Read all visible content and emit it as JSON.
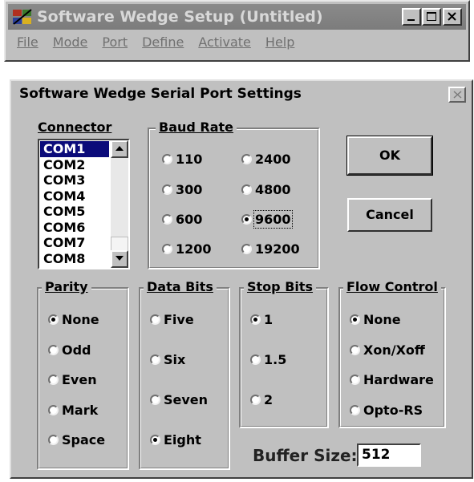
{
  "main_window": {
    "title": "Software Wedge Setup (Untitled)",
    "menu": [
      {
        "label": "File"
      },
      {
        "label": "Mode"
      },
      {
        "label": "Port"
      },
      {
        "label": "Define"
      },
      {
        "label": "Activate"
      },
      {
        "label": "Help"
      }
    ]
  },
  "dialog": {
    "title": "Software Wedge Serial Port Settings",
    "connector": {
      "label": "Connector",
      "items": [
        "COM1",
        "COM2",
        "COM3",
        "COM4",
        "COM5",
        "COM6",
        "COM7",
        "COM8"
      ],
      "selected": "COM1"
    },
    "baud_rate": {
      "label": "Baud  Rate",
      "options": [
        "110",
        "2400",
        "300",
        "4800",
        "600",
        "9600",
        "1200",
        "19200"
      ],
      "selected": "9600"
    },
    "parity": {
      "label": "Parity",
      "options": [
        "None",
        "Odd",
        "Even",
        "Mark",
        "Space"
      ],
      "selected": "None"
    },
    "data_bits": {
      "label": "Data Bits",
      "options": [
        "Five",
        "Six",
        "Seven",
        "Eight"
      ],
      "selected": "Eight"
    },
    "stop_bits": {
      "label": "Stop Bits",
      "options": [
        "1",
        "1.5",
        "2"
      ],
      "selected": "1"
    },
    "flow_control": {
      "label": "Flow Control",
      "options": [
        "None",
        "Xon/Xoff",
        "Hardware",
        "Opto-RS"
      ],
      "selected": "None"
    },
    "buttons": {
      "ok": "OK",
      "cancel": "Cancel"
    },
    "buffer_size": {
      "label": "Buffer Size:",
      "value": "512"
    }
  }
}
